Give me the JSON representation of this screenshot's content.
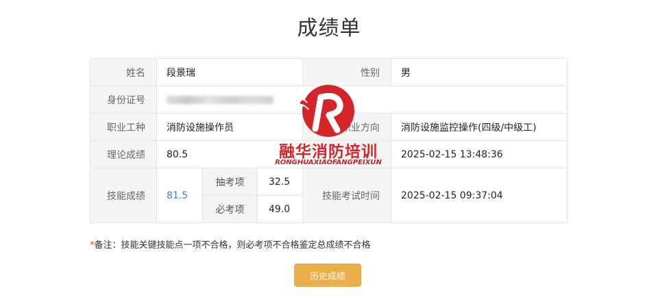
{
  "page": {
    "title": "成绩单"
  },
  "rows": {
    "name_label": "姓名",
    "name_value": "段景瑞",
    "gender_label": "性别",
    "gender_value": "男",
    "id_label": "身份证号",
    "job_label": "职业工种",
    "job_value": "消防设施操作员",
    "direction_label": "职业方向",
    "direction_value": "消防设施监控操作(四级/中级工)",
    "theory_label": "理论成绩",
    "theory_value": "80.5",
    "theory_time": "2025-02-15 13:48:36",
    "skill_label": "技能成绩",
    "skill_value": "81.5",
    "drawn_label": "抽考项",
    "drawn_value": "32.5",
    "required_label": "必考项",
    "required_value": "49.0",
    "skill_time_label": "技能考试时间",
    "skill_time": "2025-02-15 09:37:04"
  },
  "note": {
    "star": "*",
    "text": "备注：技能关键技能点一项不合格，则必考项不合格鉴定总成绩不合格"
  },
  "history_button": "历史成绩",
  "watermark": {
    "text": "融华消防培训",
    "sub": "RONGHUAXIAOFANGPEIXUN"
  },
  "colors": {
    "accent": "#e9ad4a",
    "link": "#3a7fd5",
    "watermark": "#d4252b"
  }
}
